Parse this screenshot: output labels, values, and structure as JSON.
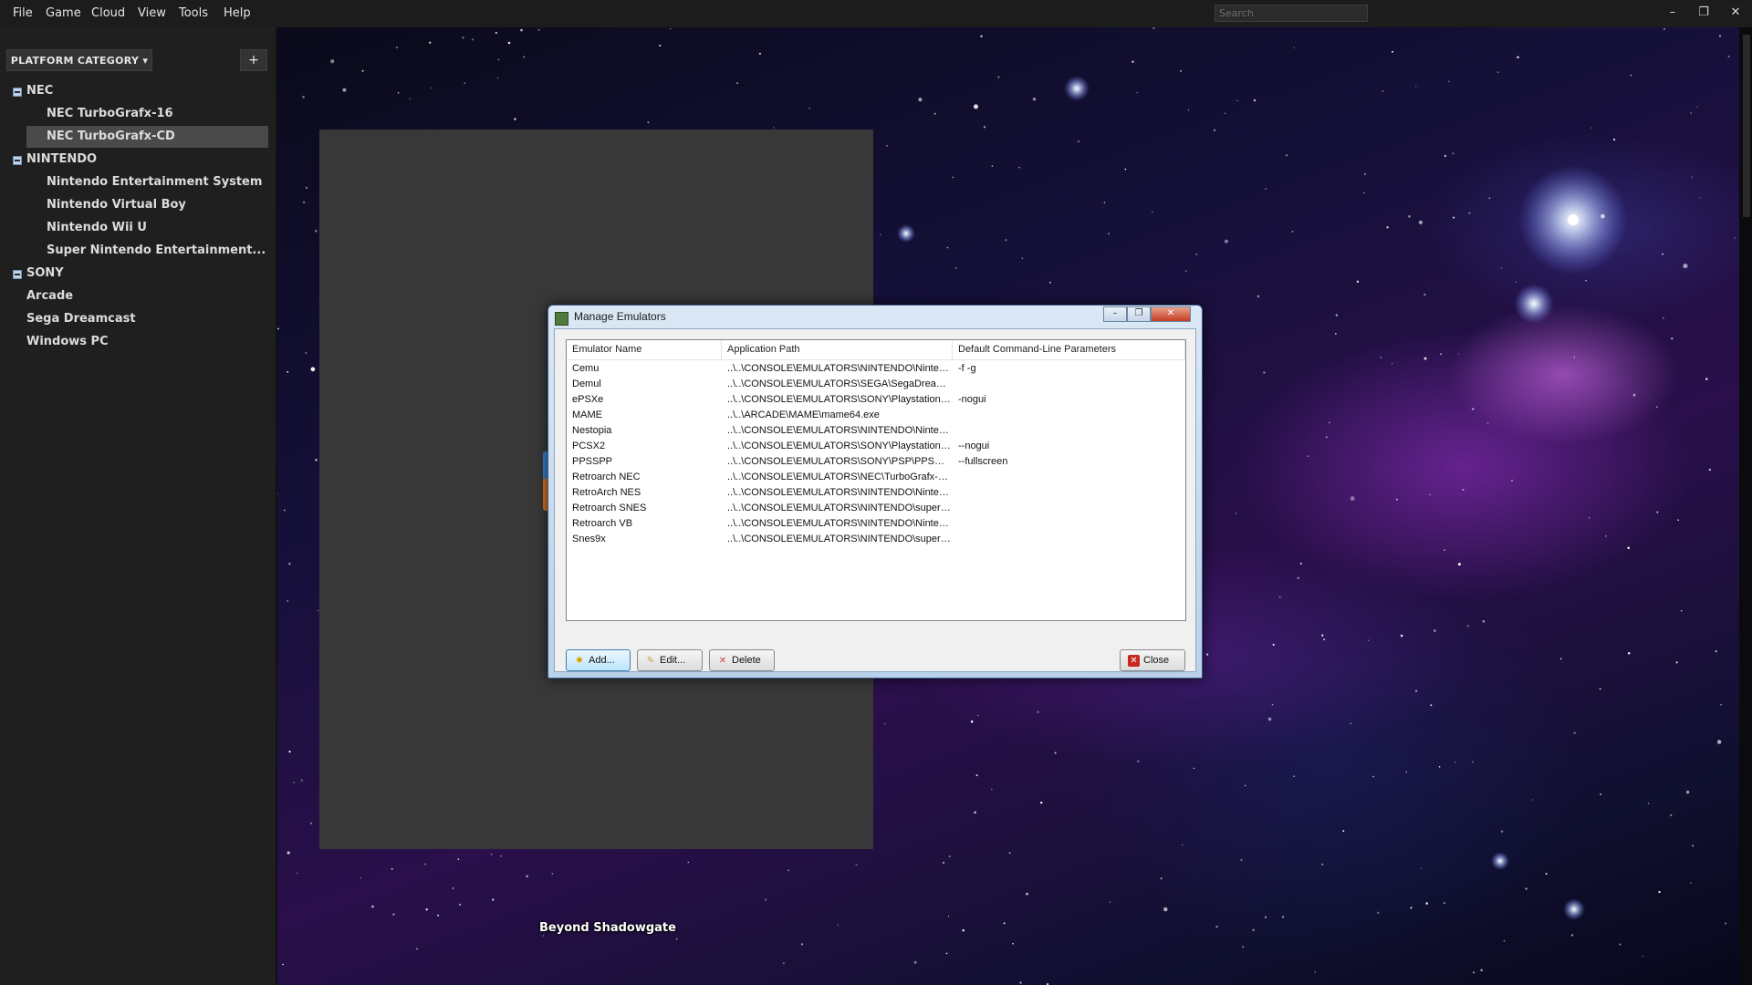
{
  "menu": [
    "File",
    "Game",
    "Cloud",
    "View",
    "Tools",
    "Help"
  ],
  "search": {
    "placeholder": "Search"
  },
  "window_controls": {
    "minimize": "–",
    "restore": "❐",
    "close": "✕"
  },
  "sidebar": {
    "category_button": "PLATFORM CATEGORY ▾",
    "add_button": "+",
    "tree": [
      {
        "label": "NEC",
        "type": "group"
      },
      {
        "label": "NEC TurboGrafx-16",
        "type": "child"
      },
      {
        "label": "NEC TurboGrafx-CD",
        "type": "child",
        "selected": true
      },
      {
        "label": "NINTENDO",
        "type": "group"
      },
      {
        "label": "Nintendo Entertainment System",
        "type": "child"
      },
      {
        "label": "Nintendo Virtual Boy",
        "type": "child"
      },
      {
        "label": "Nintendo Wii U",
        "type": "child"
      },
      {
        "label": "Super Nintendo Entertainment...",
        "type": "child"
      },
      {
        "label": "SONY",
        "type": "group"
      },
      {
        "label": "Arcade",
        "type": "item"
      },
      {
        "label": "Sega Dreamcast",
        "type": "item"
      },
      {
        "label": "Windows PC",
        "type": "item"
      }
    ]
  },
  "game": {
    "title": "Beyond Shadowgate"
  },
  "dialog": {
    "title": "Manage Emulators",
    "columns": [
      "Emulator Name",
      "Application Path",
      "Default Command-Line Parameters"
    ],
    "rows": [
      [
        "Cemu",
        "..\\..\\CONSOLE\\EMULATORS\\NINTENDO\\Ninten...",
        "-f -g"
      ],
      [
        "Demul",
        "..\\..\\CONSOLE\\EMULATORS\\SEGA\\SegaDreamc...",
        ""
      ],
      [
        "ePSXe",
        "..\\..\\CONSOLE\\EMULATORS\\SONY\\Playstation\\...",
        "-nogui"
      ],
      [
        "MAME",
        "..\\..\\ARCADE\\MAME\\mame64.exe",
        ""
      ],
      [
        "Nestopia",
        "..\\..\\CONSOLE\\EMULATORS\\NINTENDO\\Ninten...",
        ""
      ],
      [
        "PCSX2",
        "..\\..\\CONSOLE\\EMULATORS\\SONY\\Playstation ...",
        "--nogui"
      ],
      [
        "PPSSPP",
        "..\\..\\CONSOLE\\EMULATORS\\SONY\\PSP\\PPSSPP...",
        "--fullscreen"
      ],
      [
        "Retroarch NEC",
        "..\\..\\CONSOLE\\EMULATORS\\NEC\\TurboGrafx-1...",
        ""
      ],
      [
        "RetroArch NES",
        "..\\..\\CONSOLE\\EMULATORS\\NINTENDO\\Ninten...",
        ""
      ],
      [
        "Retroarch SNES",
        "..\\..\\CONSOLE\\EMULATORS\\NINTENDO\\superN...",
        ""
      ],
      [
        "Retroarch VB",
        "..\\..\\CONSOLE\\EMULATORS\\NINTENDO\\Ninten...",
        ""
      ],
      [
        "Snes9x",
        "..\\..\\CONSOLE\\EMULATORS\\NINTENDO\\superN...",
        ""
      ]
    ],
    "buttons": {
      "add": "Add...",
      "edit": "Edit...",
      "delete": "Delete",
      "close": "Close"
    },
    "icons": {
      "add": "star-icon",
      "edit": "pencil-icon",
      "delete": "x-icon",
      "close": "close-red-icon"
    }
  },
  "colors": {
    "selection": "#4a4a4a",
    "sidebar_bg": "#1f1f1f",
    "menubar_bg": "#1c1c1c"
  }
}
